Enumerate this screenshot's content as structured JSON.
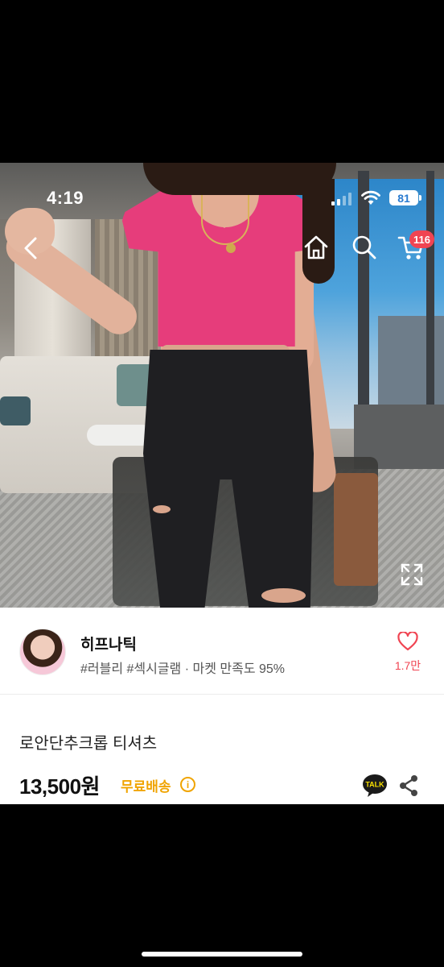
{
  "status_bar": {
    "time": "4:19",
    "battery": "81"
  },
  "nav": {
    "back_icon": "chevron-left-icon",
    "home_icon": "home-icon",
    "search_icon": "search-icon",
    "cart_icon": "cart-icon",
    "cart_count": "116"
  },
  "photo": {
    "expand_icon": "expand-icon"
  },
  "shop": {
    "name": "히프나틱",
    "tags": "#러블리 #섹시글램 · 마켓 만족도 95%",
    "like_count": "1.7만"
  },
  "product": {
    "title": "로안단추크롭 티셔츠",
    "price": "13,500원",
    "shipping": "무료배송",
    "info_glyph": "i",
    "talk_label": "TALK"
  },
  "colors": {
    "accent_red": "#f04452",
    "shipping_orange": "#f0a400",
    "talk_yellow": "#fae100"
  }
}
